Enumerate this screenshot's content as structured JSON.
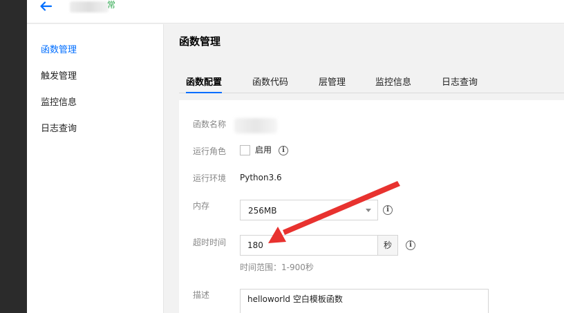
{
  "topbar": {
    "back_icon": "arrow-left-icon",
    "status": "常"
  },
  "sidebar": {
    "items": [
      {
        "label": "函数管理",
        "active": true
      },
      {
        "label": "触发管理",
        "active": false
      },
      {
        "label": "监控信息",
        "active": false
      },
      {
        "label": "日志查询",
        "active": false
      }
    ]
  },
  "main": {
    "title": "函数管理",
    "tabs": [
      {
        "label": "函数配置",
        "active": true
      },
      {
        "label": "函数代码",
        "active": false
      },
      {
        "label": "层管理",
        "active": false
      },
      {
        "label": "监控信息",
        "active": false
      },
      {
        "label": "日志查询",
        "active": false
      }
    ]
  },
  "form": {
    "name_label": "函数名称",
    "role_label": "运行角色",
    "role_checkbox_label": "启用",
    "runtime_label": "运行环境",
    "runtime_value": "Python3.6",
    "memory_label": "内存",
    "memory_value": "256MB",
    "timeout_label": "超时时间",
    "timeout_value": "180",
    "timeout_unit": "秒",
    "timeout_hint": "时间范围：1-900秒",
    "desc_label": "描述",
    "desc_value": "helloworld 空白模板函数",
    "info_icon_glyph": "i"
  },
  "colors": {
    "accent": "#006eff",
    "arrow": "#e8322f",
    "status": "#2fa84f"
  }
}
